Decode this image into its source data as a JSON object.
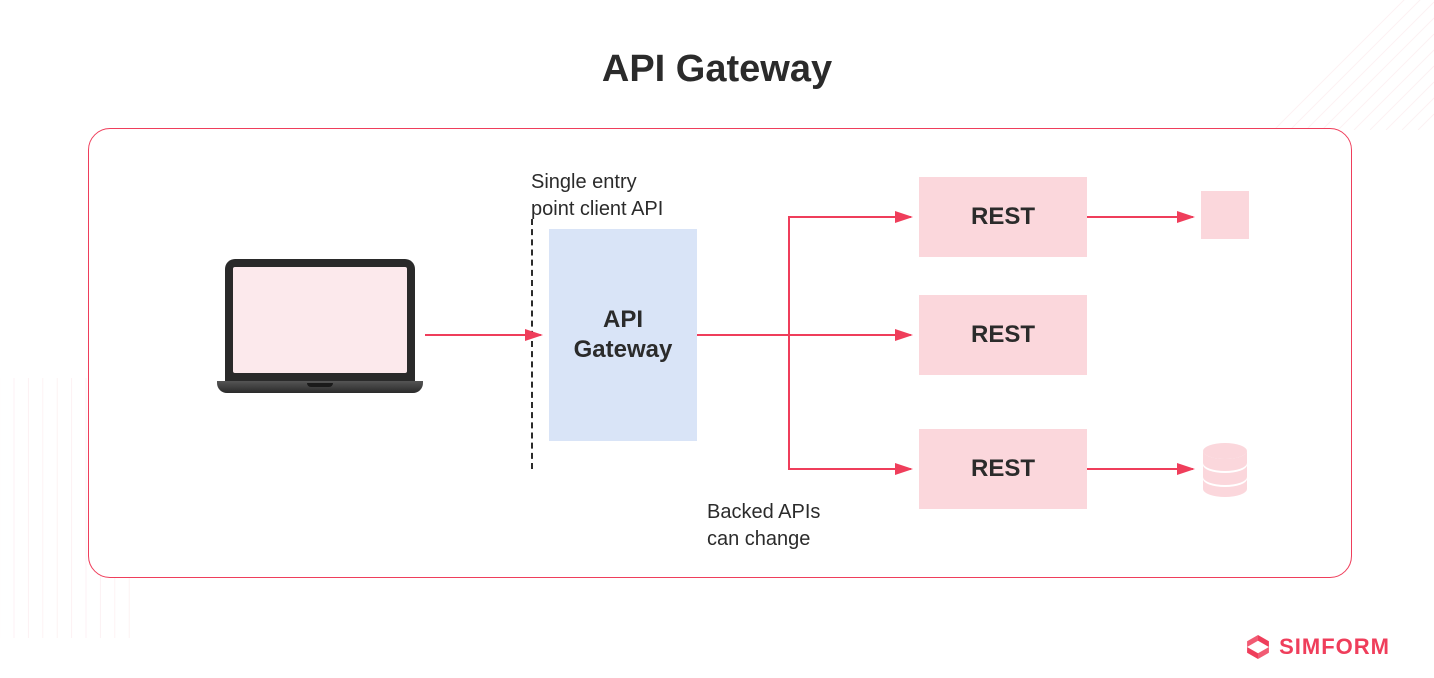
{
  "title": "API Gateway",
  "labels": {
    "entry": "Single entry\npoint client API",
    "backed": "Backed APIs\ncan change"
  },
  "gateway": "API\nGateway",
  "rest_nodes": [
    "REST",
    "REST",
    "REST"
  ],
  "brand": "SIMFORM",
  "colors": {
    "accent": "#ef3e5b",
    "pink_fill": "#fbd7dc",
    "blue_fill": "#d9e4f7"
  }
}
